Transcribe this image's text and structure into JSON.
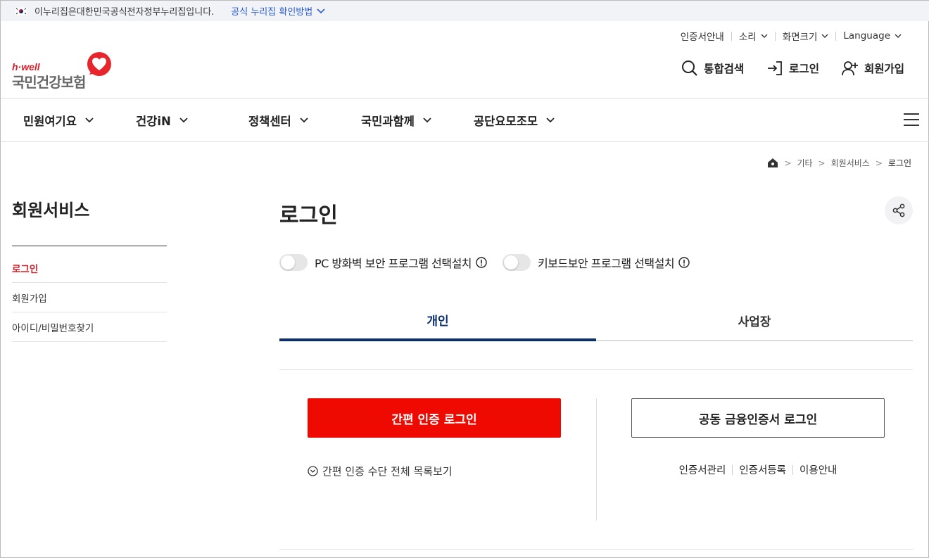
{
  "gov_banner": {
    "text": "이누리집은대한민국공식전자정부누리집입니다.",
    "link": "공식 누리집 확인방법"
  },
  "utility": {
    "items": [
      "인증서안내",
      "소리",
      "화면크기",
      "Language"
    ]
  },
  "logo": {
    "brand": "h·well",
    "name": "국민건강보험"
  },
  "header_actions": {
    "search": "통합검색",
    "login": "로그인",
    "signup": "회원가입"
  },
  "gnb": {
    "items": [
      "민원여기요",
      "건강iN",
      "정책센터",
      "국민과함께",
      "공단요모조모"
    ]
  },
  "breadcrumb": {
    "items": [
      "기타",
      "회원서비스",
      "로그인"
    ]
  },
  "sidebar": {
    "title": "회원서비스",
    "items": [
      "로그인",
      "회원가입",
      "아이디/비밀번호찾기"
    ]
  },
  "main": {
    "title": "로그인",
    "toggles": [
      "PC 방화벽 보안 프로그램 선택설치",
      "키보드보안 프로그램 선택설치"
    ],
    "tabs": [
      "개인",
      "사업장"
    ],
    "easy_login_button": "간편 인증 로그인",
    "cert_login_button": "공동 금융인증서 로그인",
    "easy_list_link": "간편 인증 수단 전체 목록보기",
    "cert_links": [
      "인증서관리",
      "인증서등록",
      "이용안내"
    ]
  },
  "colors": {
    "brand_red": "#ee0a00",
    "tab_active": "#0b2f6e",
    "link_blue": "#2a5bd7"
  }
}
